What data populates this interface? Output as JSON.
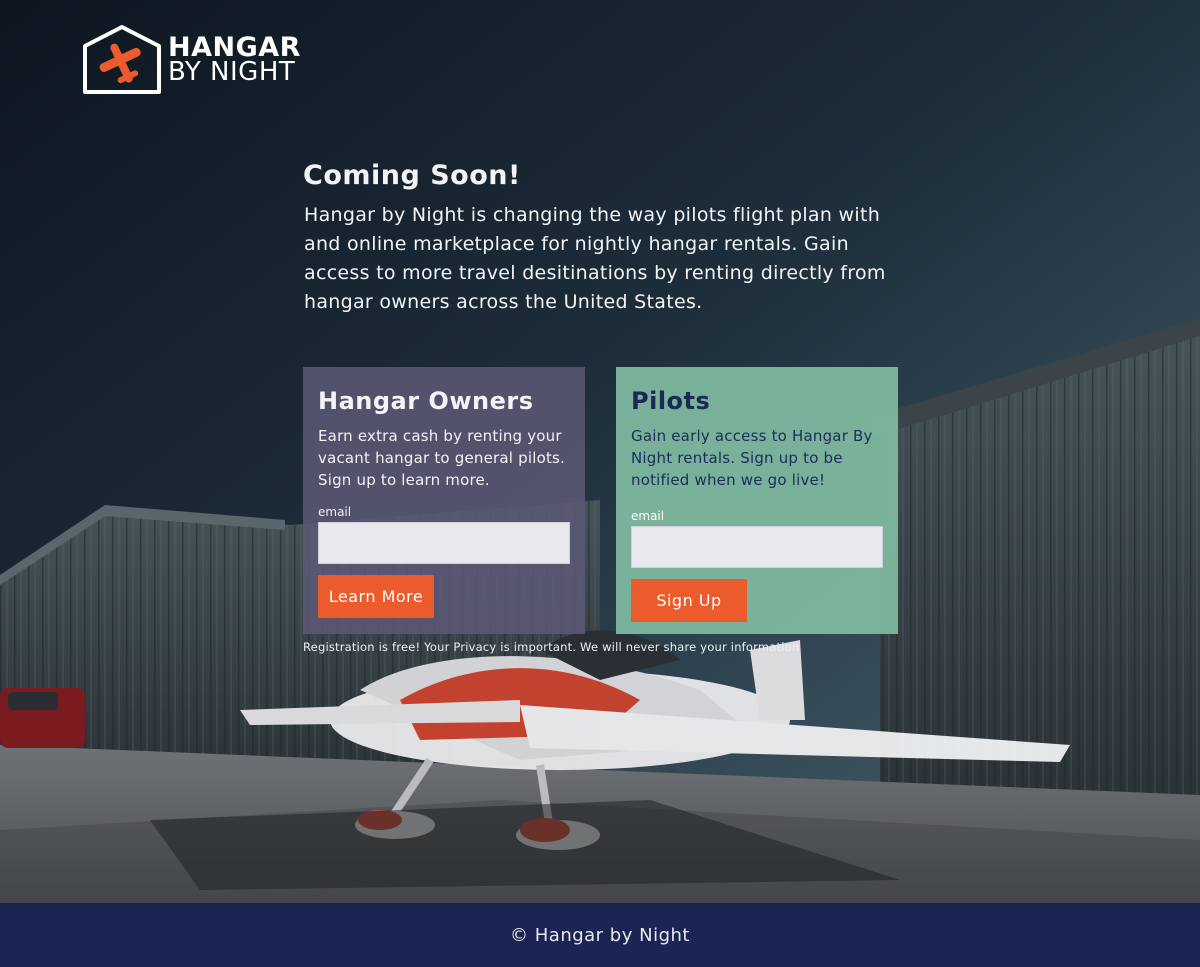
{
  "logo": {
    "line1": "HANGAR",
    "line2": "BY NIGHT",
    "icon": "hangar-plane-icon",
    "accent": "#ec5b2c"
  },
  "hero": {
    "title": "Coming Soon!",
    "body": "Hangar by Night is changing the way pilots flight plan with and online marketplace for nightly hangar rentals. Gain access to more travel desitinations by renting directly from hangar owners across the United States."
  },
  "owners_card": {
    "title": "Hangar Owners",
    "description": "Earn extra cash by renting your vacant hangar to general pilots. Sign up to learn more.",
    "email_label": "email",
    "email_value": "",
    "button_label": "Learn More",
    "background": "#5c5876"
  },
  "pilots_card": {
    "title": "Pilots",
    "description": "Gain early access to Hangar By Night rentals. Sign up to be notified when we go live!",
    "email_label": "email",
    "email_value": "",
    "button_label": "Sign Up",
    "background": "#80baa0"
  },
  "privacy_note": "Registration is free! Your Privacy is important. We will never share your information",
  "footer": {
    "copyright": "© Hangar by Night",
    "background": "#1b2554"
  }
}
